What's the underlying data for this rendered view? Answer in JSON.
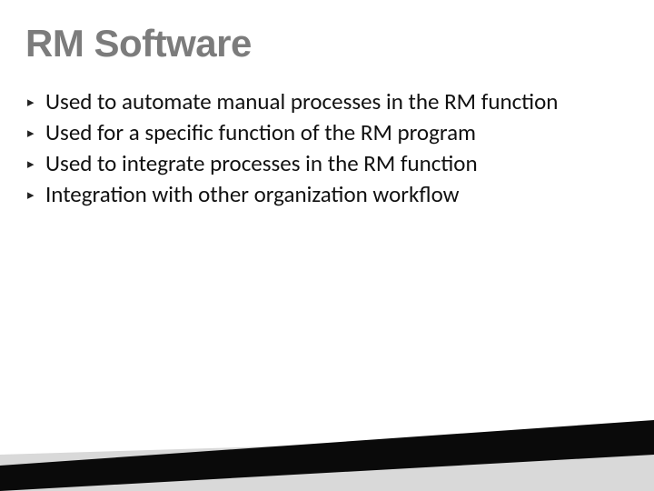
{
  "slide": {
    "title": "RM Software",
    "bullets": [
      "Used to automate manual processes in the RM function",
      "Used for a specific function of the RM program",
      "Used to integrate processes in the RM function",
      "Integration with other organization workflow"
    ]
  },
  "colors": {
    "title": "#7c7c7c",
    "text": "#111111",
    "footer_dark": "#0a0a0a",
    "footer_light": "#d9d9d9"
  }
}
